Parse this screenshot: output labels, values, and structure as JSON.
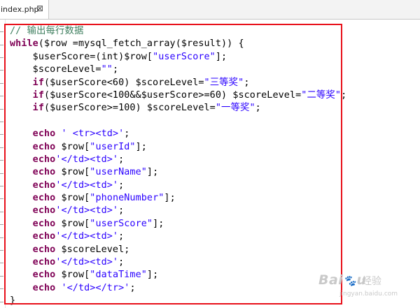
{
  "tab": {
    "label": "index.php",
    "close_glyph": "⊠"
  },
  "code_lines": [
    {
      "indent": "",
      "tokens": [
        {
          "t": "// 输出每行数据",
          "c": "cm"
        }
      ]
    },
    {
      "indent": "",
      "tokens": [
        {
          "t": "while",
          "c": "kw"
        },
        {
          "t": "($row =mysql_fetch_array($result)) {",
          "c": ""
        }
      ]
    },
    {
      "indent": "    ",
      "tokens": [
        {
          "t": "$userScore=(int)$row[",
          "c": ""
        },
        {
          "t": "\"userScore\"",
          "c": "st"
        },
        {
          "t": "];",
          "c": ""
        }
      ]
    },
    {
      "indent": "    ",
      "tokens": [
        {
          "t": "$scoreLevel=",
          "c": ""
        },
        {
          "t": "\"\"",
          "c": "st"
        },
        {
          "t": ";",
          "c": ""
        }
      ]
    },
    {
      "indent": "    ",
      "tokens": [
        {
          "t": "if",
          "c": "kw"
        },
        {
          "t": "($userScore<60) $scoreLevel=",
          "c": ""
        },
        {
          "t": "\"三等奖\"",
          "c": "st"
        },
        {
          "t": ";",
          "c": ""
        }
      ]
    },
    {
      "indent": "    ",
      "tokens": [
        {
          "t": "if",
          "c": "kw"
        },
        {
          "t": "($userScore<100&&$userScore>=60) $scoreLevel=",
          "c": ""
        },
        {
          "t": "\"二等奖\"",
          "c": "st"
        },
        {
          "t": ";",
          "c": ""
        }
      ]
    },
    {
      "indent": "    ",
      "tokens": [
        {
          "t": "if",
          "c": "kw"
        },
        {
          "t": "($userScore>=100) $scoreLevel=",
          "c": ""
        },
        {
          "t": "\"一等奖\"",
          "c": "st"
        },
        {
          "t": ";",
          "c": ""
        }
      ]
    },
    {
      "indent": "",
      "tokens": []
    },
    {
      "indent": "    ",
      "tokens": [
        {
          "t": "echo",
          "c": "kw"
        },
        {
          "t": " ",
          "c": ""
        },
        {
          "t": "' <tr><td>'",
          "c": "st"
        },
        {
          "t": ";",
          "c": ""
        }
      ]
    },
    {
      "indent": "    ",
      "tokens": [
        {
          "t": "echo",
          "c": "kw"
        },
        {
          "t": " $row[",
          "c": ""
        },
        {
          "t": "\"userId\"",
          "c": "st"
        },
        {
          "t": "];",
          "c": ""
        }
      ]
    },
    {
      "indent": "    ",
      "tokens": [
        {
          "t": "echo",
          "c": "kw"
        },
        {
          "t": "'</td><td>'",
          "c": "st"
        },
        {
          "t": ";",
          "c": ""
        }
      ]
    },
    {
      "indent": "    ",
      "tokens": [
        {
          "t": "echo",
          "c": "kw"
        },
        {
          "t": " $row[",
          "c": ""
        },
        {
          "t": "\"userName\"",
          "c": "st"
        },
        {
          "t": "];",
          "c": ""
        }
      ]
    },
    {
      "indent": "    ",
      "tokens": [
        {
          "t": "echo",
          "c": "kw"
        },
        {
          "t": "'</td><td>'",
          "c": "st"
        },
        {
          "t": ";",
          "c": ""
        }
      ]
    },
    {
      "indent": "    ",
      "tokens": [
        {
          "t": "echo",
          "c": "kw"
        },
        {
          "t": " $row[",
          "c": ""
        },
        {
          "t": "\"phoneNumber\"",
          "c": "st"
        },
        {
          "t": "];",
          "c": ""
        }
      ]
    },
    {
      "indent": "    ",
      "tokens": [
        {
          "t": "echo",
          "c": "kw"
        },
        {
          "t": "'</td><td>'",
          "c": "st"
        },
        {
          "t": ";",
          "c": ""
        }
      ]
    },
    {
      "indent": "    ",
      "tokens": [
        {
          "t": "echo",
          "c": "kw"
        },
        {
          "t": " $row[",
          "c": ""
        },
        {
          "t": "\"userScore\"",
          "c": "st"
        },
        {
          "t": "];",
          "c": ""
        }
      ]
    },
    {
      "indent": "    ",
      "tokens": [
        {
          "t": "echo",
          "c": "kw"
        },
        {
          "t": "'</td><td>'",
          "c": "st"
        },
        {
          "t": ";",
          "c": ""
        }
      ]
    },
    {
      "indent": "    ",
      "tokens": [
        {
          "t": "echo",
          "c": "kw"
        },
        {
          "t": " $scoreLevel;",
          "c": ""
        }
      ]
    },
    {
      "indent": "    ",
      "tokens": [
        {
          "t": "echo",
          "c": "kw"
        },
        {
          "t": "'</td><td>'",
          "c": "st"
        },
        {
          "t": ";",
          "c": ""
        }
      ]
    },
    {
      "indent": "    ",
      "tokens": [
        {
          "t": "echo",
          "c": "kw"
        },
        {
          "t": " $row[",
          "c": ""
        },
        {
          "t": "\"dataTime\"",
          "c": "st"
        },
        {
          "t": "];",
          "c": ""
        }
      ]
    },
    {
      "indent": "    ",
      "tokens": [
        {
          "t": "echo",
          "c": "kw"
        },
        {
          "t": " ",
          "c": ""
        },
        {
          "t": "'</td></tr>'",
          "c": "st"
        },
        {
          "t": ";",
          "c": ""
        }
      ]
    },
    {
      "indent": "",
      "tokens": [
        {
          "t": "}",
          "c": ""
        }
      ]
    }
  ],
  "colors": {
    "comment": "#3f7f5f",
    "keyword": "#7f0055",
    "string": "#2a00ff",
    "annotation_box": "#e8101a"
  },
  "watermark": {
    "logo": "Bai 经验",
    "url": "jingyan.baidu.com"
  }
}
